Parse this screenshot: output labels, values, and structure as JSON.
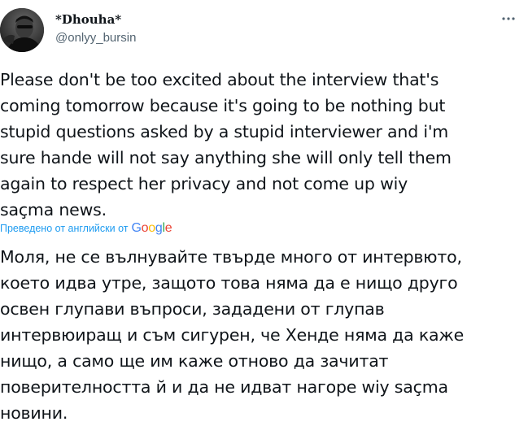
{
  "author": {
    "display_name": "*Dhouha*",
    "handle": "@onlyy_bursin",
    "avatar_icon": "profile-photo"
  },
  "header": {
    "more_icon": "more-horizontal-icon"
  },
  "tweet": {
    "text": "Please don't be too excited about the interview that's\ncoming tomorrow because it's going to be nothing but\nstupid questions asked by a stupid interviewer and i'm\nsure hande will not say anything she will only tell them\nagain to respect her privacy and not come up wiy\nsaçma news."
  },
  "translation": {
    "label": "Преведено от английски от",
    "provider_logo": {
      "letters": [
        "G",
        "o",
        "o",
        "g",
        "l",
        "e"
      ],
      "colors": [
        "#4285F4",
        "#EA4335",
        "#FBBC05",
        "#4285F4",
        "#34A853",
        "#EA4335"
      ]
    },
    "text": "Моля, не се вълнувайте твърде много от интервюто,\nкоето идва утре, защото това няма да е нищо друго\nосвен глупави въпроси, зададени от глупав\nинтервюиращ и съм сигурен, че Хенде няма да каже\nнищо, а само ще им каже отново да зачитат\nповерителността й и да не идват нагоре wiy saçma\nновини."
  },
  "colors": {
    "link": "#1d9bf0",
    "text": "#0f1419",
    "secondary": "#536471"
  }
}
